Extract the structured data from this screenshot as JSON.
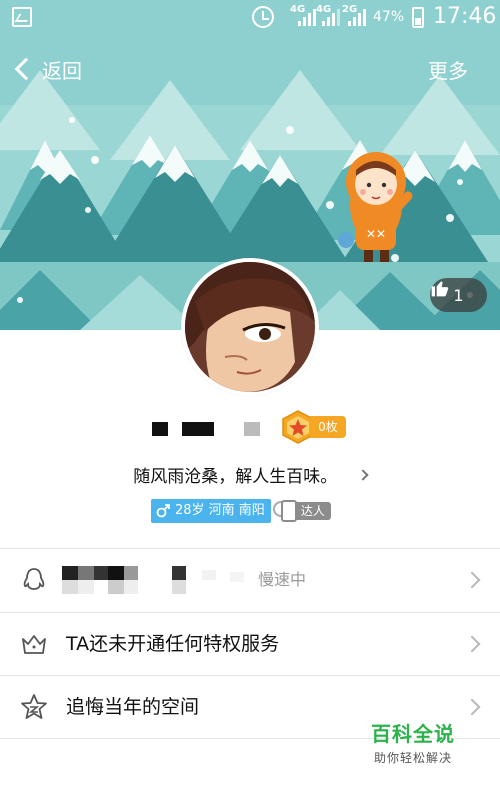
{
  "status_bar": {
    "network_1": "4G",
    "network_2": "4G",
    "network_3": "2G",
    "battery": "47%",
    "time": "17:46"
  },
  "nav": {
    "back_label": "返回",
    "more_label": "更多"
  },
  "banner": {
    "like_count": "1"
  },
  "profile": {
    "level_label": "0枚",
    "signature": "随风雨沧桑，解人生百味。",
    "info_tag": "28岁 河南 南阳",
    "expert_label": "达人"
  },
  "list": {
    "qq_status": "慢速中",
    "vip_label": "TA还未开通任何特权服务",
    "space_label": "追悔当年的空间"
  },
  "watermark": {
    "title": "百科全说",
    "subtitle": "助你轻松解决"
  },
  "colors": {
    "banner_bg": "#8ed0cf",
    "tree_dark": "#3a8f93",
    "tree_light": "#5fb4b6",
    "info_tag": "#4bb4ee",
    "level_gold": "#f5a623",
    "watermark_green": "#2bb24c"
  }
}
